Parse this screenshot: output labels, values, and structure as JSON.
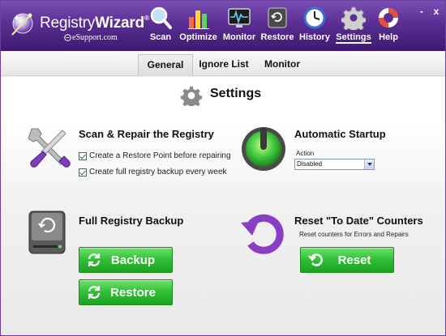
{
  "app": {
    "logo_name": "RegistryWizard",
    "logo_name_part1": "Registry",
    "logo_name_part2": "Wizard",
    "logo_sub": "eSupport.com",
    "trademark": "®"
  },
  "nav": {
    "items": [
      {
        "label": "Scan",
        "icon": "magnifier-icon"
      },
      {
        "label": "Optimize",
        "icon": "bar-chart-icon"
      },
      {
        "label": "Monitor",
        "icon": "heartbeat-monitor-icon"
      },
      {
        "label": "Restore",
        "icon": "restore-drive-icon"
      },
      {
        "label": "History",
        "icon": "clock-icon"
      },
      {
        "label": "Settings",
        "icon": "gear-icon",
        "active": true
      },
      {
        "label": "Help",
        "icon": "lifebuoy-icon"
      }
    ]
  },
  "window_controls": {
    "minimize": "-",
    "close": "x"
  },
  "tabs": [
    {
      "label": "General",
      "active": true
    },
    {
      "label": "Ignore List",
      "active": false
    },
    {
      "label": "Monitor",
      "active": false
    }
  ],
  "page": {
    "title": "Settings"
  },
  "scan_repair": {
    "title": "Scan & Repair the Registry",
    "options": [
      {
        "label": "Create a Restore Point before repairing",
        "checked": true
      },
      {
        "label": "Create full registry backup every week",
        "checked": true
      }
    ]
  },
  "startup": {
    "title": "Automatic Startup",
    "action_label": "Action",
    "action_value": "Disabled"
  },
  "backup": {
    "title": "Full Registry Backup",
    "backup_button": "Backup",
    "restore_button": "Restore"
  },
  "reset": {
    "title": "Reset \"To Date\" Counters",
    "description": "Reset counters for Errors and Repairs",
    "reset_button": "Reset"
  },
  "colors": {
    "header_purple": "#5a2e93",
    "accent_green": "#2fbf35",
    "reset_purple": "#8a3ec4"
  }
}
